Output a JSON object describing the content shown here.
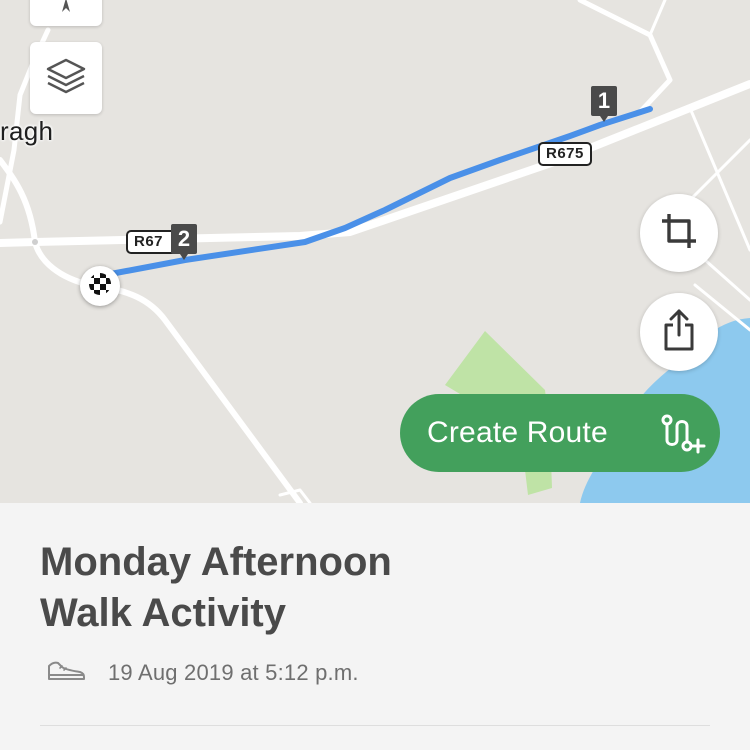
{
  "map": {
    "place_label": "ragh",
    "roads": [
      "R675",
      "R67"
    ],
    "lap_markers": [
      "1",
      "2"
    ],
    "colors": {
      "background": "#e6e4e0",
      "route": "#4a90e8",
      "water": "#8dc9ee",
      "park": "#bfe3a6"
    },
    "controls": {
      "compass": "compass-icon",
      "layers": "layers-icon",
      "crop": "crop-icon",
      "share": "share-icon"
    }
  },
  "create_route": {
    "label": "Create Route",
    "icon": "route-plus-icon",
    "color": "#43a05c"
  },
  "activity": {
    "title_line1": "Monday Afternoon",
    "title_line2": "Walk Activity",
    "type_icon": "shoe-icon",
    "date": "19 Aug 2019 at 5:12 p.m."
  }
}
